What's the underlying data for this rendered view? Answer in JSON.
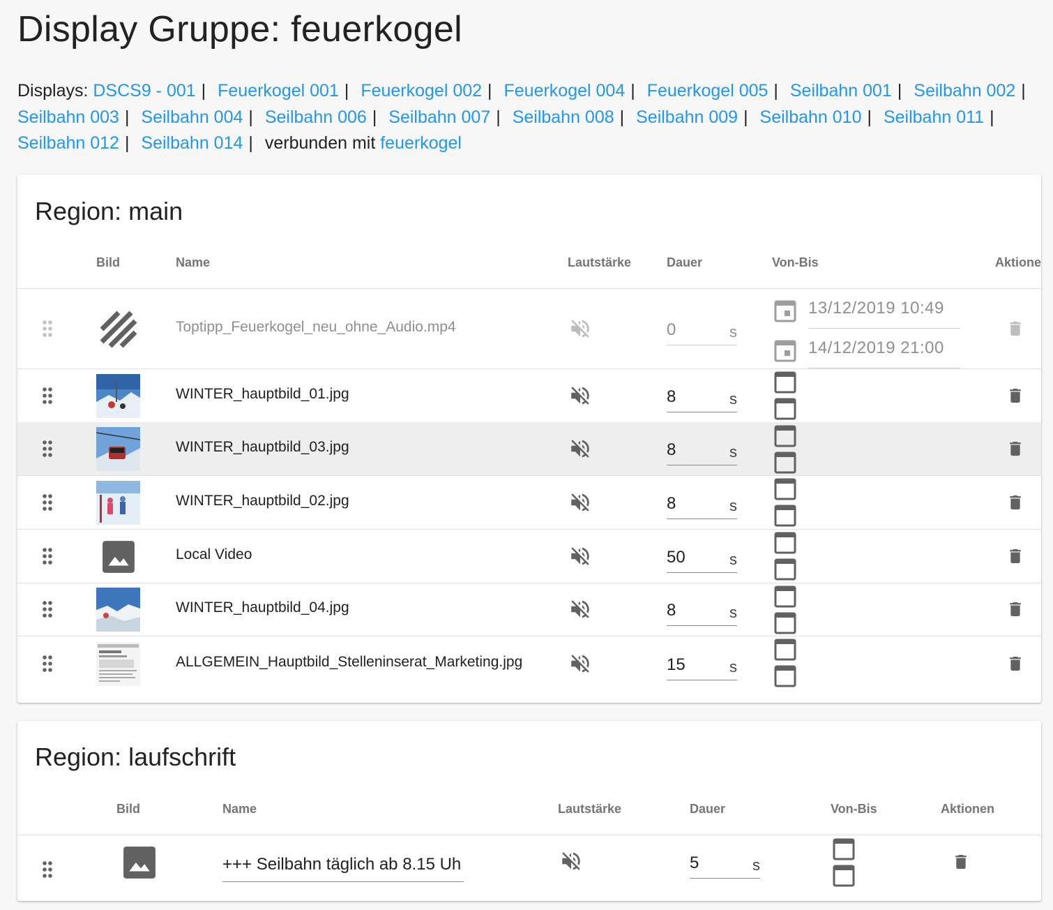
{
  "page": {
    "title": "Display Gruppe: feuerkogel"
  },
  "displays": {
    "label": "Displays:",
    "items": [
      "DSCS9 - 001",
      "Feuerkogel 001",
      "Feuerkogel 002",
      "Feuerkogel 004",
      "Feuerkogel 005",
      "Seilbahn 001",
      "Seilbahn 002",
      "Seilbahn 003",
      "Seilbahn 004",
      "Seilbahn 006",
      "Seilbahn 007",
      "Seilbahn 008",
      "Seilbahn 009",
      "Seilbahn 010",
      "Seilbahn 011",
      "Seilbahn 012",
      "Seilbahn 014"
    ],
    "separator": "|",
    "connected_label": "verbunden mit",
    "connected_link": "feuerkogel"
  },
  "regions": [
    {
      "title": "Region: main",
      "headers": {
        "bild": "Bild",
        "name": "Name",
        "lautstaerke": "Lautstärke",
        "dauer": "Dauer",
        "vonbis": "Von-Bis",
        "aktionen": "Aktione"
      },
      "rows": [
        {
          "name": "Toptipp_Feuerkogel_neu_ohne_Audio.mp4",
          "thumb": "striped-disabled-icon",
          "duration": "0",
          "unit": "s",
          "muted": true,
          "disabled": true,
          "von": "13/12/2019  10:49",
          "bis": "14/12/2019  21:00"
        },
        {
          "name": "WINTER_hauptbild_01.jpg",
          "thumb": "photo-thumbnail",
          "duration": "8",
          "unit": "s",
          "muted": true
        },
        {
          "name": "WINTER_hauptbild_03.jpg",
          "thumb": "photo-thumbnail",
          "duration": "8",
          "unit": "s",
          "muted": true,
          "hover": true
        },
        {
          "name": "WINTER_hauptbild_02.jpg",
          "thumb": "photo-thumbnail",
          "duration": "8",
          "unit": "s",
          "muted": true
        },
        {
          "name": "Local Video",
          "thumb": "image-placeholder-icon",
          "duration": "50",
          "unit": "s",
          "muted": true
        },
        {
          "name": "WINTER_hauptbild_04.jpg",
          "thumb": "photo-thumbnail",
          "duration": "8",
          "unit": "s",
          "muted": true
        },
        {
          "name": "ALLGEMEIN_Hauptbild_Stelleninserat_Marketing.jpg",
          "thumb": "document-thumbnail",
          "duration": "15",
          "unit": "s",
          "muted": true
        }
      ]
    },
    {
      "title": "Region: laufschrift",
      "headers": {
        "bild": "Bild",
        "name": "Name",
        "lautstaerke": "Lautstärke",
        "dauer": "Dauer",
        "vonbis": "Von-Bis",
        "aktionen": "Aktionen"
      },
      "rows": [
        {
          "name": "+++ Seilbahn täglich ab 8.15 Uh",
          "thumb": "image-placeholder-icon",
          "duration": "5",
          "unit": "s",
          "muted": true
        }
      ]
    }
  ],
  "colors": {
    "link": "#2196f3",
    "icon": "#616161",
    "hover_row": "#eeeeee"
  }
}
